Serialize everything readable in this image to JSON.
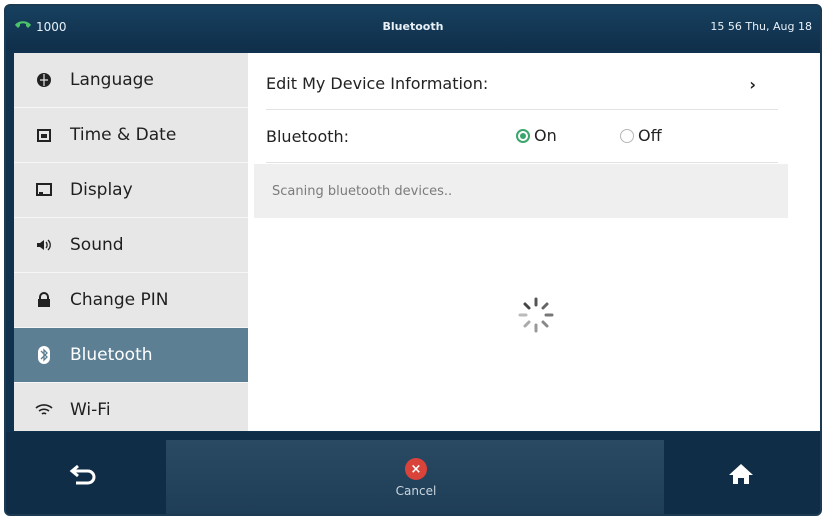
{
  "status": {
    "line": "1000",
    "title": "Bluetooth",
    "datetime": "15 56 Thu, Aug 18"
  },
  "sidebar": {
    "items": [
      {
        "label": "Language",
        "icon": "globe-icon"
      },
      {
        "label": "Time & Date",
        "icon": "calendar-icon"
      },
      {
        "label": "Display",
        "icon": "display-icon"
      },
      {
        "label": "Sound",
        "icon": "speaker-icon"
      },
      {
        "label": "Change PIN",
        "icon": "lock-icon"
      },
      {
        "label": "Bluetooth",
        "icon": "bluetooth-icon",
        "active": true
      },
      {
        "label": "Wi-Fi",
        "icon": "wifi-icon"
      }
    ]
  },
  "main": {
    "edit_device_label": "Edit My Device Information:",
    "chevron": "›",
    "bluetooth_label": "Bluetooth:",
    "on_label": "On",
    "off_label": "Off",
    "bluetooth_state": "On",
    "scan_message": "Scaning bluetooth devices.."
  },
  "bottom": {
    "cancel_label": "Cancel"
  },
  "colors": {
    "accent_green": "#3aa66b",
    "active_item": "#5c7f93",
    "cancel_red": "#d9433a"
  }
}
